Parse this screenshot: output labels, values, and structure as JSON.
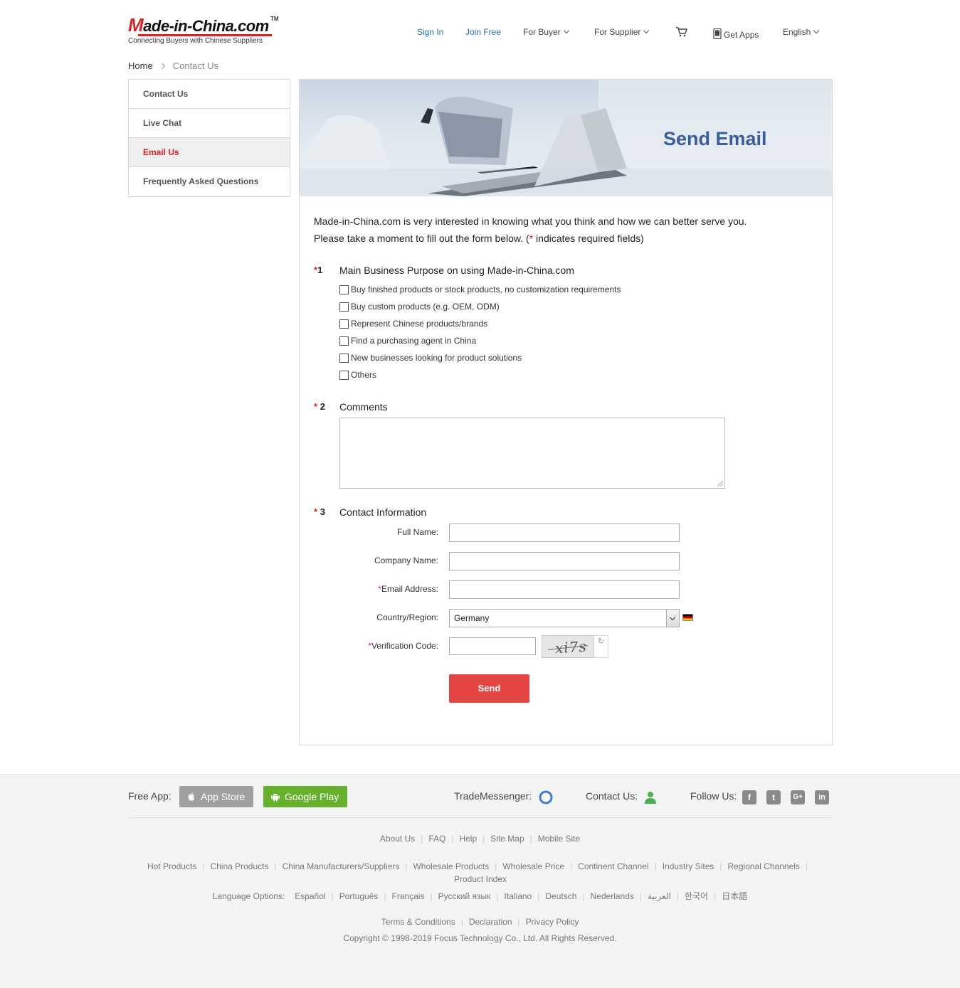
{
  "header": {
    "logo_text": "Made-in-China.com",
    "logo_tm": "TM",
    "tagline": "Connecting Buyers with Chinese Suppliers",
    "sign_in": "Sign In",
    "join_free": "Join Free",
    "for_buyer": "For Buyer",
    "for_supplier": "For Supplier",
    "get_apps": "Get Apps",
    "language": "English"
  },
  "breadcrumb": {
    "home": "Home",
    "current": "Contact Us"
  },
  "sidebar": {
    "items": [
      {
        "label": "Contact Us"
      },
      {
        "label": "Live Chat"
      },
      {
        "label": "Email Us"
      },
      {
        "label": "Frequently Asked Questions"
      }
    ]
  },
  "banner": {
    "title": "Send Email"
  },
  "intro": {
    "line1": "Made-in-China.com is very interested in knowing what you think and how we can better serve you.",
    "line2_prefix": "Please take a moment to fill out the form below. (",
    "line2_star": "*",
    "line2_suffix": " indicates required fields)"
  },
  "form": {
    "required_mark": "*",
    "q1": {
      "num": "1",
      "title": "Main Business Purpose on using Made-in-China.com",
      "options": [
        "Buy finished products or stock products, no customization requirements",
        "Buy custom products (e.g. OEM, ODM)",
        "Represent Chinese products/brands",
        "Find a purchasing agent in China",
        "New businesses looking for product solutions",
        "Others"
      ]
    },
    "q2": {
      "num": "2",
      "title": "Comments"
    },
    "q3": {
      "num": "3",
      "title": "Contact Information",
      "full_name": "Full Name:",
      "company_name": "Company Name:",
      "email_star": "*",
      "email": "Email Address:",
      "country": "Country/Region:",
      "country_value": "Germany",
      "vcode_star": "*",
      "vcode": "Verification Code:",
      "captcha_text": "xi7s"
    },
    "send": "Send"
  },
  "footer": {
    "free_app": "Free App:",
    "app_store": "App Store",
    "google_play": "Google Play",
    "trade_messenger": "TradeMessenger:",
    "contact_us": "Contact Us:",
    "follow_us": "Follow Us:",
    "links1": [
      "About Us",
      "FAQ",
      "Help",
      "Site Map",
      "Mobile Site"
    ],
    "links2": [
      "Hot Products",
      "China Products",
      "China Manufacturers/Suppliers",
      "Wholesale Products",
      "Wholesale Price",
      "Continent Channel",
      "Industry Sites",
      "Regional Channels",
      "Product Index"
    ],
    "language_label": "Language Options:",
    "languages": [
      "Español",
      "Português",
      "Français",
      "Русский язык",
      "Italiano",
      "Deutsch",
      "Nederlands",
      "العربية",
      "한국어",
      "日本語"
    ],
    "links3": [
      "Terms & Conditions",
      "Declaration",
      "Privacy Policy"
    ],
    "copyright": "Copyright © 1998-2019 Focus Technology Co., Ltd. All Rights Reserved."
  },
  "colors": {
    "brand_red": "#d8232a",
    "link_blue": "#1c6fb5",
    "title_blue": "#3a5fa0",
    "send_red": "#e64545",
    "google_green": "#66b12b"
  }
}
